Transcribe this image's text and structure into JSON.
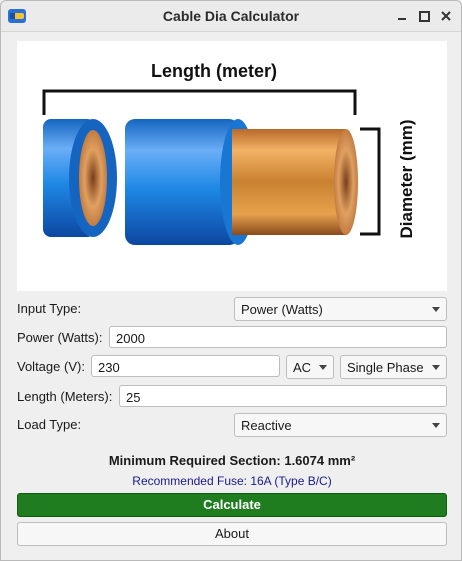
{
  "window": {
    "title": "Cable Dia Calculator"
  },
  "illustration": {
    "length_label": "Length (meter)",
    "diameter_label": "Diameter (mm)"
  },
  "form": {
    "input_type": {
      "label": "Input Type:",
      "value": "Power (Watts)"
    },
    "power": {
      "label": "Power (Watts):",
      "value": "2000"
    },
    "voltage": {
      "label": "Voltage (V):",
      "value": "230",
      "current_type": "AC",
      "phase": "Single Phase"
    },
    "length": {
      "label": "Length (Meters):",
      "value": "25"
    },
    "load_type": {
      "label": "Load Type:",
      "value": "Reactive"
    }
  },
  "results": {
    "min_section": "Minimum Required Section: 1.6074 mm²",
    "fuse": "Recommended Fuse: 16A (Type B/C)"
  },
  "buttons": {
    "calculate": "Calculate",
    "about": "About"
  },
  "colors": {
    "calculate_bg": "#1f7d1f",
    "fuse_text": "#1a1a8c",
    "cable_blue": "#1e88e5",
    "copper": "#c9812f"
  }
}
